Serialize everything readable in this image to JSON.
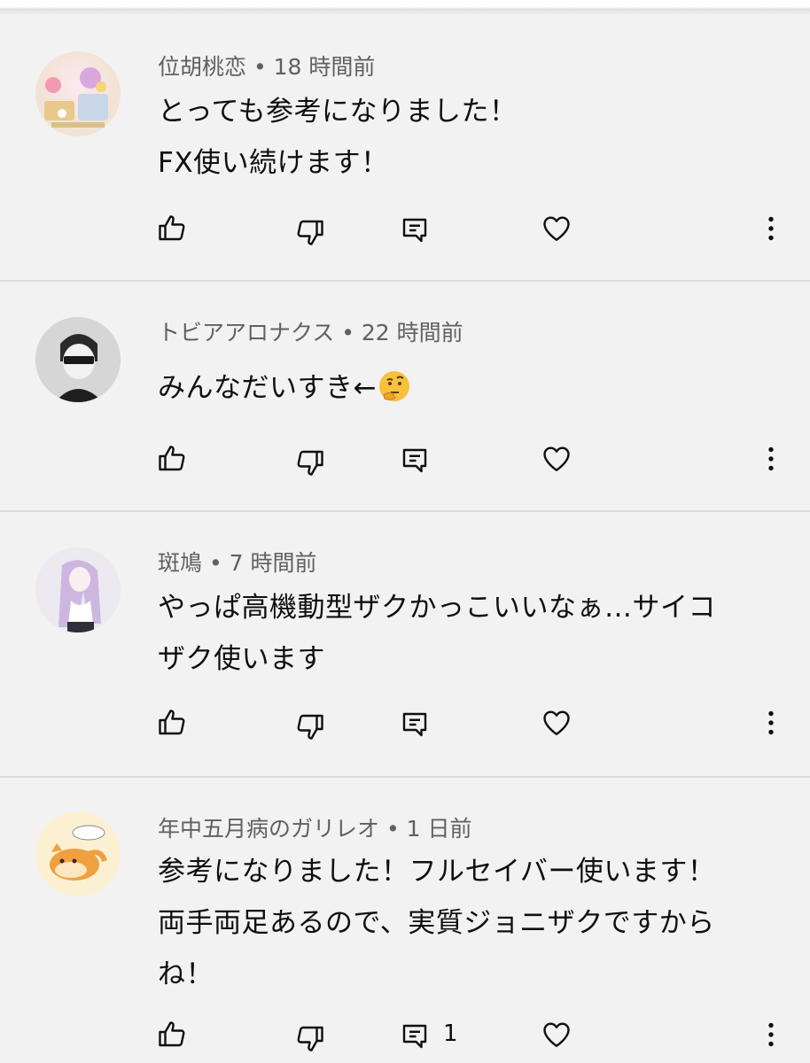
{
  "comments": [
    {
      "author": "位胡桃恋",
      "time": "18 時間前",
      "lines": [
        "とっても参考になりました！",
        "FX使い続けます！"
      ],
      "reply_count": ""
    },
    {
      "author": "トビアアロナクス",
      "time": "22 時間前",
      "lines": [
        "みんなだいすき←",
        ""
      ],
      "emoji": "thinking-face-icon",
      "reply_count": ""
    },
    {
      "author": "斑鳩",
      "time": "7 時間前",
      "lines": [
        "やっぱ高機動型ザクかっこいいなぁ…サイコ",
        "ザク使います"
      ],
      "reply_count": ""
    },
    {
      "author": "年中五月病のガリレオ",
      "time": "1 日前",
      "lines": [
        "参考になりました！フルセイバー使います！",
        "両手両足あるので、実質ジョニザクですから",
        "ね！"
      ],
      "reply_count": "1"
    }
  ],
  "meta_separator": " • ",
  "icons": {
    "like": "thumbs-up-icon",
    "dislike": "thumbs-down-icon",
    "reply": "reply-icon",
    "heart": "heart-icon",
    "more": "more-vertical-icon"
  },
  "colors": {
    "background": "#f2f2f2",
    "divider": "#dcdcdc",
    "meta_text": "#606060",
    "body_text": "#0f0f0f"
  }
}
